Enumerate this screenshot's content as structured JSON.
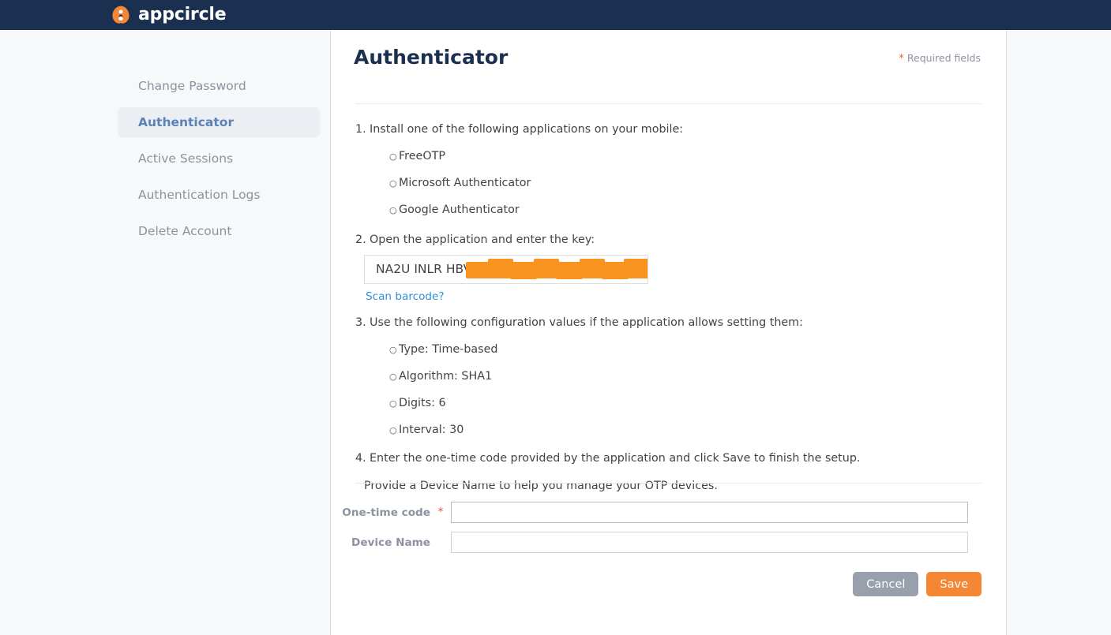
{
  "header": {
    "logo_text": "appcircle",
    "logo_icon": "appcircle-logo-icon",
    "bg_color": "#1b3050",
    "accent_color": "#f58634"
  },
  "sidebar": {
    "items": [
      {
        "label": "Change Password",
        "active": false
      },
      {
        "label": "Authenticator",
        "active": true
      },
      {
        "label": "Active Sessions",
        "active": false
      },
      {
        "label": "Authentication Logs",
        "active": false
      },
      {
        "label": "Delete Account",
        "active": false
      }
    ]
  },
  "main": {
    "title": "Authenticator",
    "required_note": {
      "star": "*",
      "text": "Required fields"
    },
    "steps": [
      {
        "number": "1.",
        "text": "Install one of the following applications on your mobile:",
        "sub_items": [
          "FreeOTP",
          "Microsoft Authenticator",
          "Google Authenticator"
        ]
      },
      {
        "number": "2.",
        "text": "Open the application and enter the key:",
        "sub_items": []
      },
      {
        "number": "3.",
        "text": "Use the following configuration values if the application allows setting them:",
        "sub_items": [
          "Type: Time-based",
          "Algorithm: SHA1",
          "Digits: 6",
          "Interval: 30"
        ]
      },
      {
        "number": "4.",
        "text": "Enter the one-time code provided by the application and click Save to finish the setup.",
        "sub_items": []
      }
    ],
    "secret_key": {
      "value": "NA2U INLR HBV",
      "redacted": true,
      "redaction_color": "#f7931e"
    },
    "scan_barcode_link": "Scan barcode?",
    "device_name_note": "Provide a Device Name to help you manage your OTP devices."
  },
  "form": {
    "fields": [
      {
        "label": "One-time code",
        "required_star": "*",
        "value": "",
        "placeholder": "",
        "focused": true
      },
      {
        "label": "Device Name",
        "required_star": "",
        "value": "",
        "placeholder": "",
        "focused": false
      }
    ],
    "buttons": {
      "cancel": "Cancel",
      "save": "Save"
    }
  }
}
